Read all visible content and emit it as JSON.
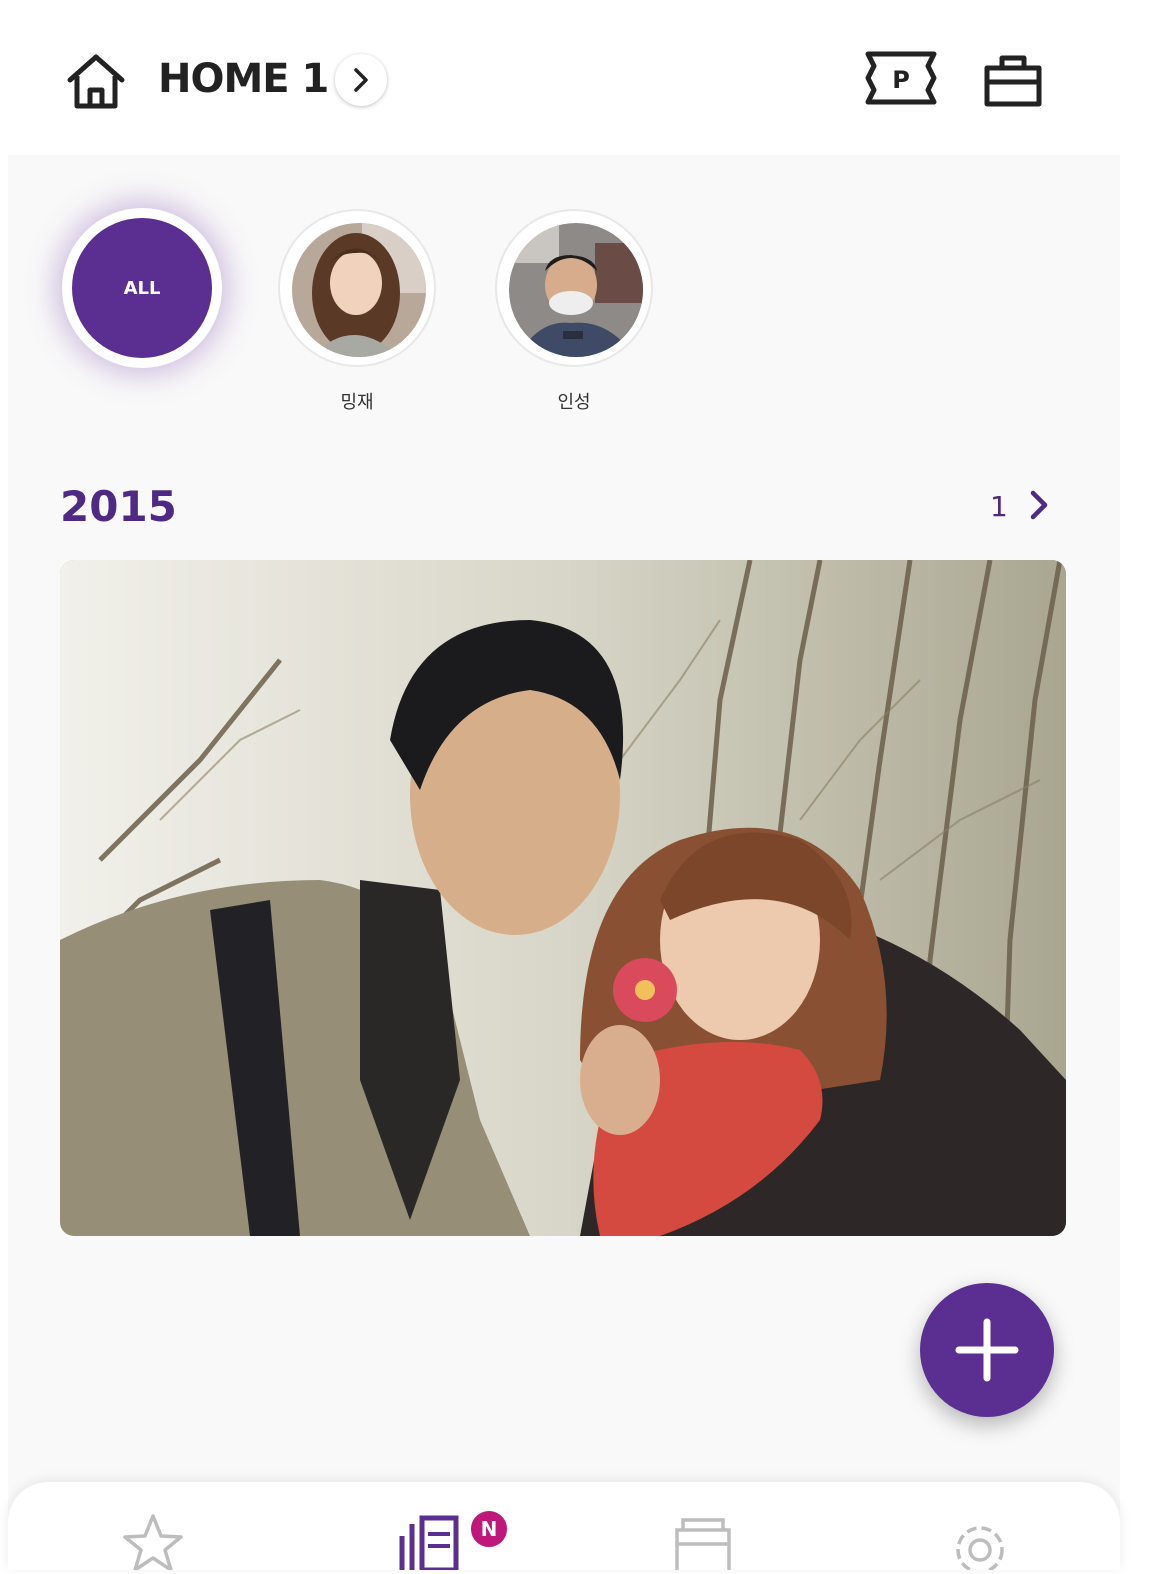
{
  "header": {
    "title": "HOME 1",
    "icons": [
      "home-icon",
      "chevron-right-icon",
      "ticket-p-icon",
      "shopping-bag-icon"
    ],
    "ticket_letter": "P"
  },
  "profiles": [
    {
      "label": "ALL",
      "selected": true
    },
    {
      "name": "밍재"
    },
    {
      "name": "인성"
    }
  ],
  "timeline": {
    "year": "2015",
    "count": "1"
  },
  "fab": {
    "icon": "plus-icon"
  },
  "bottom_nav": {
    "items": [
      {
        "icon": "star-icon",
        "active": false
      },
      {
        "icon": "feed-icon",
        "active": true,
        "badge": "N"
      },
      {
        "icon": "album-icon",
        "active": false
      },
      {
        "icon": "settings-gear-icon",
        "active": false
      }
    ]
  },
  "colors": {
    "accent": "#5b2f92",
    "badge": "#c0177a",
    "background": "#f9f9f9"
  }
}
